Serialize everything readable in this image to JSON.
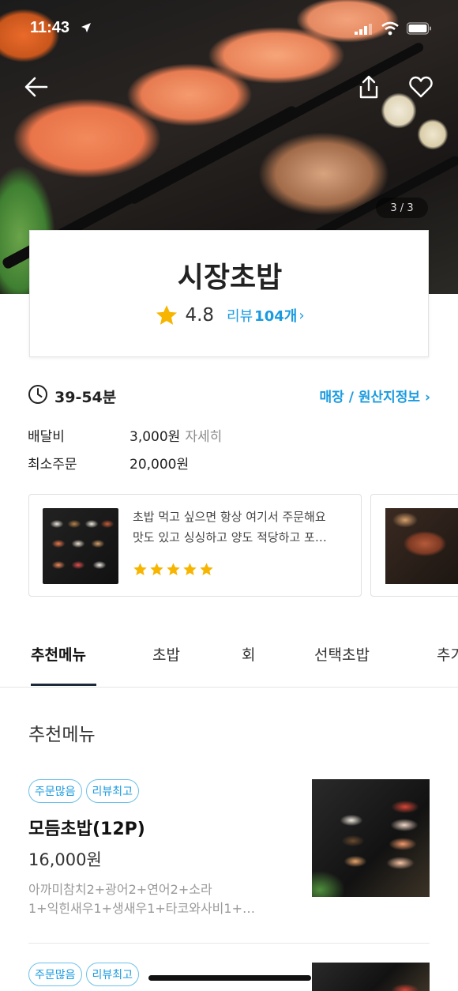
{
  "status_bar": {
    "time": "11:43"
  },
  "hero": {
    "page_indicator": "3 / 3"
  },
  "store": {
    "name": "시장초밥",
    "rating": "4.8",
    "review_prefix": "리뷰",
    "review_count": "104개",
    "review_chevron": "›"
  },
  "delivery": {
    "time_range": "39-54분",
    "origin_link": "매장 / 원산지정보 ›",
    "fee_label": "배달비",
    "fee_value": "3,000원",
    "fee_detail": "자세히",
    "min_order_label": "최소주문",
    "min_order_value": "20,000원"
  },
  "reviews": [
    {
      "text_line1": "초밥 먹고 싶으면 항상 여기서 주문해요",
      "text_line2": "맛도 있고 싱싱하고 양도 적당하고 포…",
      "stars": 5,
      "star_color": "#f7b500"
    }
  ],
  "tabs": [
    "추천메뉴",
    "초밥",
    "회",
    "선택초밥",
    "추가"
  ],
  "section_title": "추천메뉴",
  "menu_items": [
    {
      "badges": [
        "주문많음",
        "리뷰최고"
      ],
      "name": "모듬초밥(12P)",
      "price": "16,000원",
      "desc_line1": "아까미참치2+광어2+연어2+소라",
      "desc_line2": "1+익힌새우1+생새우1+타코와사비1+…"
    },
    {
      "badges": [
        "주문많음",
        "리뷰최고"
      ]
    }
  ],
  "colors": {
    "accent": "#1a9be0",
    "star": "#f7b500",
    "tab_underline": "#1a2a3a"
  },
  "icons": [
    "back-arrow-icon",
    "share-icon",
    "heart-icon",
    "star-icon",
    "clock-icon",
    "location-arrow-icon",
    "signal-icon",
    "wifi-icon",
    "battery-icon"
  ]
}
